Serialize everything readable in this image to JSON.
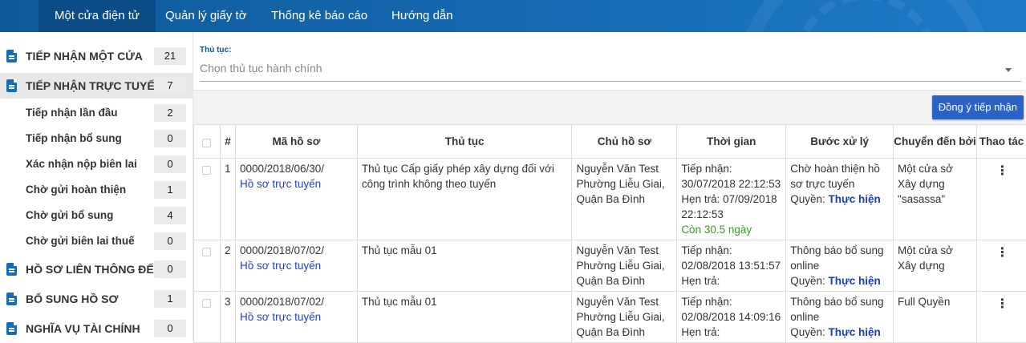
{
  "nav": {
    "items": [
      "Một cửa điện tử",
      "Quản lý giấy tờ",
      "Thống kê báo cáo",
      "Hướng dẫn"
    ]
  },
  "sidebar": {
    "items": [
      {
        "label": "TIẾP NHẬN MỘT CỬA",
        "count": "21",
        "icon": "document-icon"
      },
      {
        "label": "TIẾP NHẬN TRỰC TUYẾN",
        "count": "7",
        "icon": "document-icon"
      },
      {
        "label": "Tiếp nhận lần đầu",
        "count": "2"
      },
      {
        "label": "Tiếp nhận bổ sung",
        "count": "0"
      },
      {
        "label": "Xác nhận nộp biên lai",
        "count": "0"
      },
      {
        "label": "Chờ gửi hoàn thiện",
        "count": "1"
      },
      {
        "label": "Chờ gửi bổ sung",
        "count": "4"
      },
      {
        "label": "Chờ gửi biên lai thuế",
        "count": "0"
      },
      {
        "label": "HỒ SƠ LIÊN THÔNG ĐẾN",
        "count": "0",
        "icon": "document-icon"
      },
      {
        "label": "BỔ SUNG HỒ SƠ",
        "count": "1",
        "icon": "document-icon"
      },
      {
        "label": "NGHĨA VỤ TÀI CHÍNH",
        "count": "0",
        "icon": "document-icon"
      }
    ]
  },
  "filter": {
    "label": "Thủ tục:",
    "placeholder": "Chọn thủ tục hành chính"
  },
  "actions": {
    "accept_label": "Đồng ý tiếp nhận"
  },
  "table": {
    "headers": [
      "#",
      "Mã hồ sơ",
      "Thủ tục",
      "Chủ hồ sơ",
      "Thời gian",
      "Bước xử lý",
      "Chuyển đến bởi",
      "Thao tác"
    ],
    "rows": [
      {
        "num": "1",
        "code": "0000/2018/06/30/",
        "code_link": "Hồ sơ trực tuyến",
        "procedure": "Thủ tục Cấp giấy phép xây dựng đối với công trình không theo tuyến",
        "owner": "Nguyễn Văn Test Phường Liễu Giai, Quận Ba Đình",
        "time_received": "Tiếp nhận: 30/07/2018 22:12:53",
        "time_due": "Hẹn trả: 07/09/2018 22:12:53",
        "time_remaining": "Còn 30.5 ngày",
        "step": "Chờ hoàn thiện hồ sơ trực tuyến",
        "perm_label": "Quyền:",
        "perm_value": "Thực hiện",
        "from": "Một cửa sở Xây dựng \"sasassa\""
      },
      {
        "num": "2",
        "code": "0000/2018/07/02/",
        "code_link": "Hồ sơ trực tuyến",
        "procedure": "Thủ tục mẫu 01",
        "owner": "Nguyễn Văn Test Phường Liễu Giai, Quận Ba Đình",
        "time_received": "Tiếp nhận: 02/08/2018 13:51:57",
        "time_due": "Hẹn trả:",
        "time_remaining": "",
        "step": "Thông báo bổ sung online",
        "perm_label": "Quyền:",
        "perm_value": "Thực hiện",
        "from": "Một cửa sở Xây dựng"
      },
      {
        "num": "3",
        "code": "0000/2018/07/02/",
        "code_link": "Hồ sơ trực tuyến",
        "procedure": "Thủ tục mẫu 01",
        "owner": "Nguyễn Văn Test Phường Liễu Giai, Quận Ba Đình",
        "time_received": "Tiếp nhận: 02/08/2018 14:09:16",
        "time_due": "Hẹn trả:",
        "time_remaining": "",
        "step": "Thông báo bổ sung online",
        "perm_label": "Quyền:",
        "perm_value": "Thực hiện",
        "from": "Full Quyền"
      }
    ]
  },
  "colors": {
    "nav_bg": "#166cb5",
    "nav_active": "#0b4c86",
    "accent_button": "#2b62c4",
    "link": "#2140c9",
    "remaining": "#3a9a2a"
  }
}
